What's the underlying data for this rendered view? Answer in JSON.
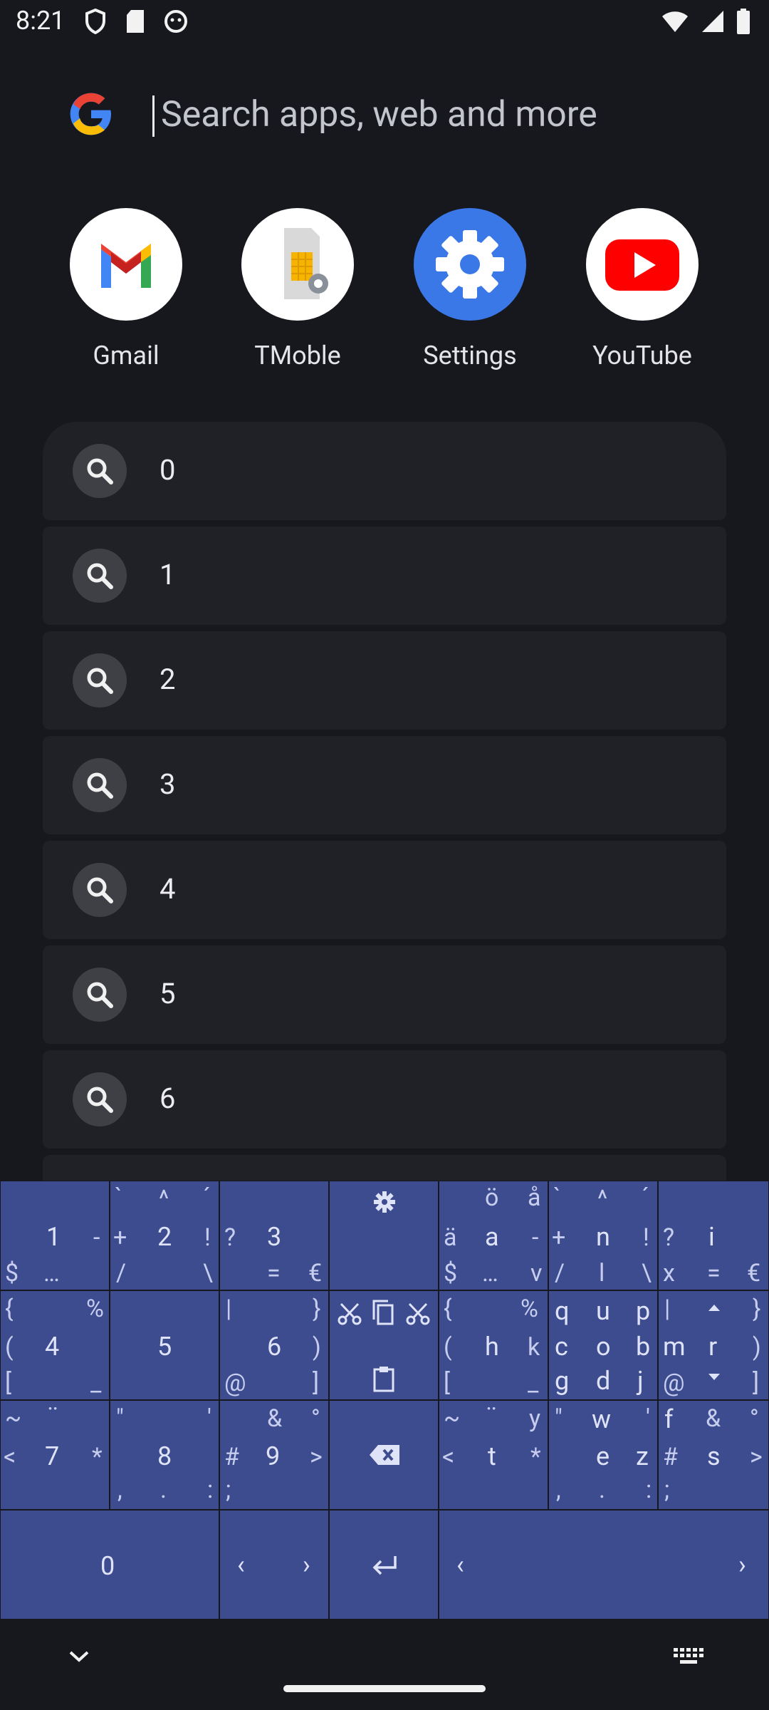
{
  "status_bar": {
    "time": "8:21"
  },
  "search": {
    "placeholder": "Search apps, web and more"
  },
  "apps": [
    {
      "name": "Gmail"
    },
    {
      "name": "TMoble"
    },
    {
      "name": "Settings"
    },
    {
      "name": "YouTube"
    }
  ],
  "suggestions": [
    "0",
    "1",
    "2",
    "3",
    "4",
    "5",
    "6"
  ],
  "keyboard": {
    "k1": {
      "main": "1",
      "tl": "",
      "tr": "",
      "ml": "",
      "mr": "-",
      "bl": "$",
      "bm": "…",
      "br": ""
    },
    "k2": {
      "main": "2",
      "tl": "`",
      "tm": "^",
      "tr": "´",
      "ml": "+",
      "mr": "!",
      "bl": "/",
      "br": "\\"
    },
    "k3": {
      "main": "3",
      "ml": "?",
      "bm": "=",
      "br": "€"
    },
    "kA": {
      "tm": "ö",
      "tr": "å",
      "ml": "ä",
      "main": "a",
      "mr": "-",
      "bl": "$",
      "bm": "…",
      "br": "v"
    },
    "kN": {
      "tl": "`",
      "tm": "^",
      "tr": "´",
      "ml": "+",
      "main": "n",
      "mr": "!",
      "bl": "/",
      "bm": "l",
      "br": "\\"
    },
    "kI": {
      "ml": "?",
      "mr": "i",
      "bl": "x",
      "bm": "=",
      "br": "€"
    },
    "k4": {
      "tl": "{",
      "tr": "%",
      "ml": "(",
      "main": "4",
      "bl": "[",
      "br": "_"
    },
    "k5": {
      "main": "5"
    },
    "k6": {
      "tl": "|",
      "tr": "}",
      "main": "6",
      "mr": ")",
      "bl": "@",
      "br": "]"
    },
    "kH": {
      "tl": "{",
      "tr": "%",
      "ml": "(",
      "main": "h",
      "mr": "k",
      "bl": "[",
      "br": "_"
    },
    "kQ": {
      "tl": "q",
      "tm": "u",
      "tr": "p",
      "ml": "c",
      "main": "o",
      "mr": "b",
      "bl": "g",
      "bm": "d",
      "br": "j"
    },
    "kM": {
      "tl": "|",
      "tr": "}",
      "ml": "m",
      "main": "r",
      "mr": ")",
      "bl": "@",
      "br": "]"
    },
    "k7": {
      "tl": "~",
      "tm": "¨",
      "ml": "<",
      "main": "7",
      "mr": "*"
    },
    "k8": {
      "tl": "\"",
      "tr": "'",
      "main": "8",
      "bl": ",",
      "bm": ".",
      "br": ":"
    },
    "k9": {
      "tm": "&",
      "tr": "°",
      "ml": "#",
      "main": "9",
      "mr": ">",
      "bl": ";"
    },
    "kT": {
      "tl": "~",
      "tm": "¨",
      "tr": "y",
      "ml": "<",
      "main": "t",
      "mr": "*"
    },
    "kW": {
      "tl": "\"",
      "tm": "w",
      "tr": "'",
      "main": "e",
      "mr": "z",
      "bl": ",",
      "bm": ".",
      "br": ":"
    },
    "kF": {
      "tl": "f",
      "tm": "&",
      "tr": "°",
      "ml": "#",
      "main": "s",
      "mr": ">",
      "bl": ";"
    },
    "k0": {
      "main": "0"
    },
    "arrows": {
      "left": "‹",
      "right": "›"
    },
    "space": {
      "left": "‹",
      "right": "›"
    }
  },
  "colors": {
    "background": "#17181d",
    "row": "#202126",
    "keyboard": "#3d4c8f",
    "settings_blue": "#3b78e7",
    "youtube_red": "#ff0000"
  }
}
